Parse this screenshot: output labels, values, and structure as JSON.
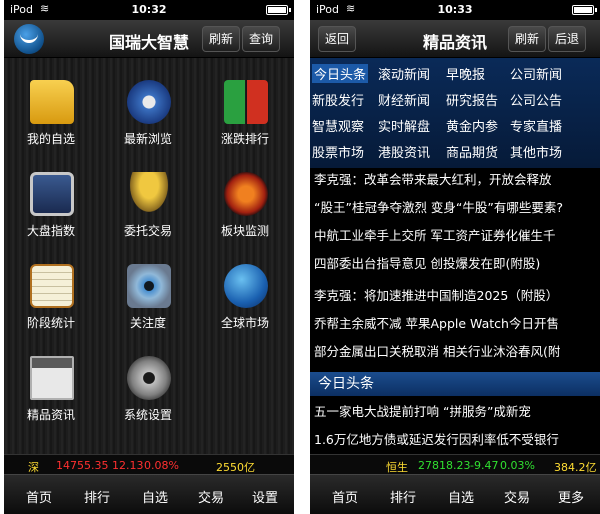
{
  "left": {
    "status": {
      "carrier": "iPod",
      "time": "10:32"
    },
    "nav": {
      "title": "国瑞大智慧",
      "refresh": "刷新",
      "query": "查询"
    },
    "tiles": [
      {
        "label": "我的自选",
        "icon": "folder-icon",
        "color": "#e8b020"
      },
      {
        "label": "最新浏览",
        "icon": "compass-icon",
        "color": "#3a70c0"
      },
      {
        "label": "涨跌排行",
        "icon": "updown-arrows-icon",
        "color": "#c03020"
      },
      {
        "label": "大盘指数",
        "icon": "monitor-chart-icon",
        "color": "#5a7ab0"
      },
      {
        "label": "委托交易",
        "icon": "handshake-coins-icon",
        "color": "#d0a030"
      },
      {
        "label": "板块监测",
        "icon": "waveform-icon",
        "color": "#c04010"
      },
      {
        "label": "阶段统计",
        "icon": "notepad-chart-icon",
        "color": "#e0c060"
      },
      {
        "label": "关注度",
        "icon": "eye-icon",
        "color": "#7090b0"
      },
      {
        "label": "全球市场",
        "icon": "globe-icon",
        "color": "#2a80d0"
      },
      {
        "label": "精品资讯",
        "icon": "newspaper-icon",
        "color": "#a0a0a0"
      },
      {
        "label": "系统设置",
        "icon": "gear-icon",
        "color": "#909090"
      }
    ],
    "ticker": {
      "market": "深",
      "value": "14755.35",
      "change": "12.13",
      "pct": "0.08%",
      "volume": "2550亿"
    },
    "tabs": [
      "首页",
      "排行",
      "自选",
      "交易",
      "设置"
    ]
  },
  "right": {
    "status": {
      "carrier": "iPod",
      "time": "10:33"
    },
    "nav": {
      "back": "返回",
      "title": "精品资讯",
      "refresh": "刷新",
      "back2": "后退"
    },
    "categories": [
      [
        "今日头条",
        "滚动新闻",
        "早晚报",
        "公司新闻"
      ],
      [
        "新股发行",
        "财经新闻",
        "研究报告",
        "公司公告"
      ],
      [
        "智慧观察",
        "实时解盘",
        "黄金内参",
        "专家直播"
      ],
      [
        "股票市场",
        "港股资讯",
        "商品期货",
        "其他市场"
      ]
    ],
    "news": [
      "李克强：改革会带来最大红利，开放会释放",
      "“股王”桂冠争夺激烈 变身“牛股”有哪些要素?",
      "中航工业牵手上交所 军工资产证券化催生千",
      "四部委出台指导意见 创投爆发在即(附股)",
      "李克强：将加速推进中国制造2025（附股）",
      "乔帮主余威不减 苹果Apple Watch今日开售",
      "部分金属出口关税取消 相关行业沐浴春风(附"
    ],
    "section": "今日头条",
    "headlines": [
      "五一家电大战提前打响 “拼服务”成新宠",
      "1.6万亿地方债或延迟发行因利率低不受银行"
    ],
    "ticker": {
      "market": "恒生",
      "value": "27818.23",
      "change": "-9.47",
      "pct": "0.03%",
      "volume": "384.2亿"
    },
    "tabs": [
      "首页",
      "排行",
      "自选",
      "交易",
      "更多"
    ]
  }
}
